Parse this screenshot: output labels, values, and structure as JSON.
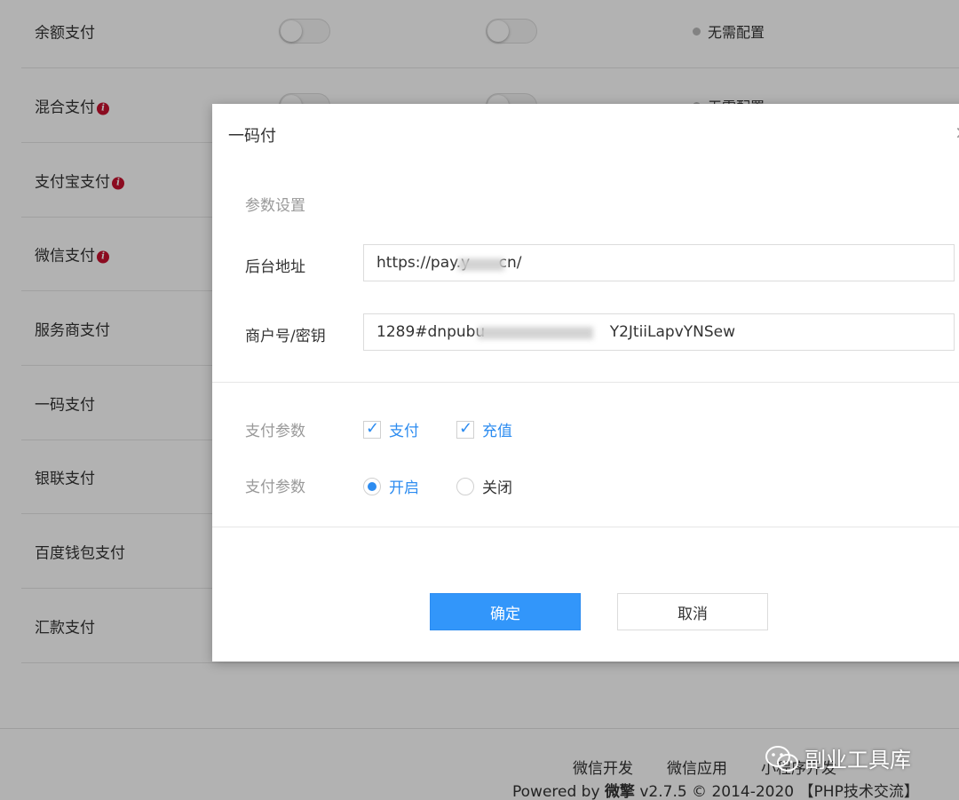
{
  "payment_list": {
    "rows": [
      {
        "name": "余额支付",
        "info": false,
        "status": "无需配置"
      },
      {
        "name": "混合支付",
        "info": true,
        "status": "无需配置"
      },
      {
        "name": "支付宝支付",
        "info": true,
        "status": ""
      },
      {
        "name": "微信支付",
        "info": true,
        "status": ""
      },
      {
        "name": "服务商支付",
        "info": false,
        "status": ""
      },
      {
        "name": "一码支付",
        "info": false,
        "status": ""
      },
      {
        "name": "银联支付",
        "info": false,
        "status": ""
      },
      {
        "name": "百度钱包支付",
        "info": false,
        "status": ""
      },
      {
        "name": "汇款支付",
        "info": false,
        "status": ""
      }
    ]
  },
  "footer": {
    "links": [
      "微信开发",
      "微信应用",
      "小程序开发"
    ],
    "copyright_prefix": "Powered by ",
    "brand": "微擎",
    "copyright_suffix": " v2.7.5 © 2014-2020 【PHP技术交流】"
  },
  "modal": {
    "title": "一码付",
    "close_glyph": "×",
    "section_label": "参数设置",
    "backend_label": "后台地址",
    "backend_value": "https://pay.y      cn/",
    "merchant_label": "商户号/密钥",
    "merchant_value": "1289#dnpubu                          Y2JtiiLapvYNSew",
    "pay_param_label_1": "支付参数",
    "check_pay": "支付",
    "check_recharge": "充值",
    "pay_param_label_2": "支付参数",
    "radio_on": "开启",
    "radio_off": "关闭",
    "confirm": "确定",
    "cancel": "取消"
  },
  "watermark": {
    "text": "副业工具库"
  },
  "colors": {
    "primary": "#3296fa",
    "check": "#2d8cf0",
    "info": "#c8102e"
  }
}
